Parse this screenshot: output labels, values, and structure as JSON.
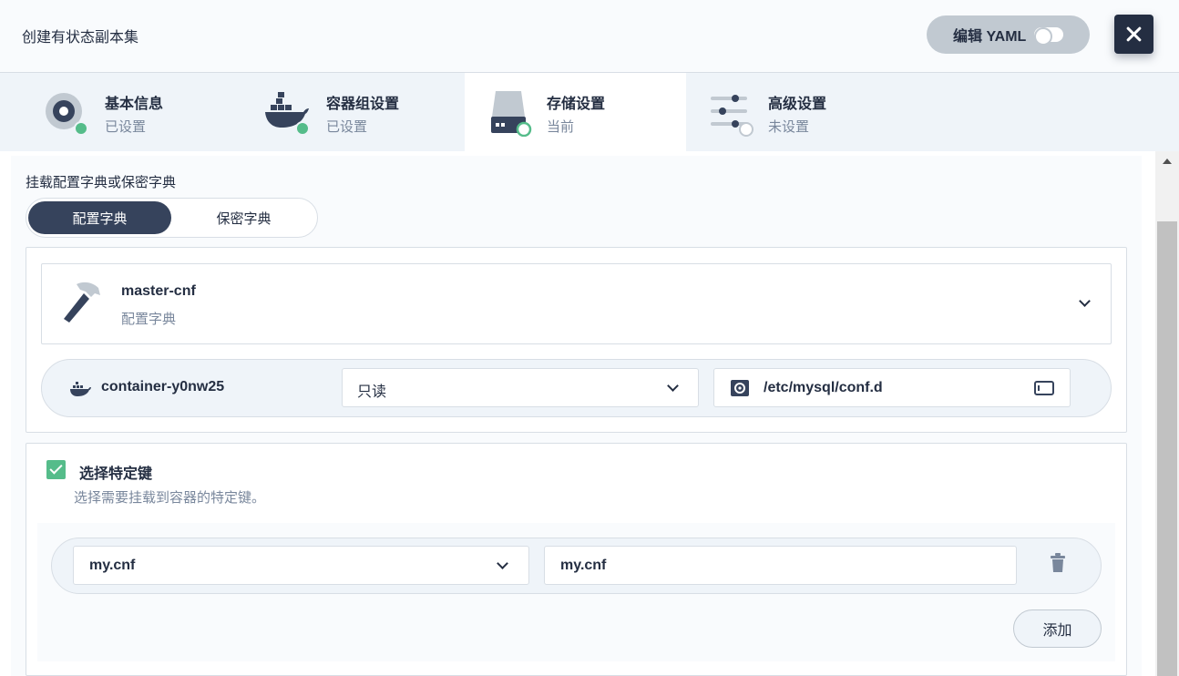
{
  "header": {
    "title": "创建有状态副本集",
    "edit_yaml_label": "编辑 YAML"
  },
  "steps": [
    {
      "title": "基本信息",
      "status": "已设置"
    },
    {
      "title": "容器组设置",
      "status": "已设置"
    },
    {
      "title": "存储设置",
      "status": "当前"
    },
    {
      "title": "高级设置",
      "status": "未设置"
    }
  ],
  "mount": {
    "section_label": "挂载配置字典或保密字典",
    "tabs": [
      "配置字典",
      "保密字典"
    ],
    "configmap_name": "master-cnf",
    "configmap_type": "配置字典",
    "container_name": "container-y0nw25",
    "access_mode": "只读",
    "mount_path": "/etc/mysql/conf.d"
  },
  "keys": {
    "title": "选择特定键",
    "description": "选择需要挂载到容器的特定键。",
    "key_value": "my.cnf",
    "path_value": "my.cnf",
    "add_label": "添加"
  },
  "colors": {
    "primary": "#242e42",
    "success": "#55bc8a",
    "muted": "#79879c",
    "border": "#d8dee5"
  }
}
